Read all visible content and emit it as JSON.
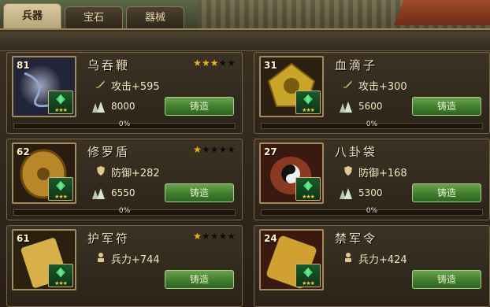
{
  "tabs": [
    {
      "label": "兵器",
      "active": true
    },
    {
      "label": "宝石",
      "active": false
    },
    {
      "label": "器械",
      "active": false
    }
  ],
  "forge_label": "铸造",
  "items": [
    {
      "level": "81",
      "name": "乌吞鞭",
      "stars_on": 3,
      "stars_total": 5,
      "stat_icon": "sword-icon",
      "stat": "攻击+595",
      "cost": "8000",
      "progress": "0%",
      "progress_value": 0,
      "gem_color": "#3bd06a"
    },
    {
      "level": "31",
      "name": "血滴子",
      "stars_on": 0,
      "stars_total": 0,
      "stat_icon": "sword-icon",
      "stat": "攻击+300",
      "cost": "5600",
      "progress": "0%",
      "progress_value": 0,
      "gem_color": "#3bd06a"
    },
    {
      "level": "62",
      "name": "修罗盾",
      "stars_on": 1,
      "stars_total": 5,
      "stat_icon": "shield-icon",
      "stat": "防御+282",
      "cost": "6550",
      "progress": "0%",
      "progress_value": 0,
      "gem_color": "#3bd06a"
    },
    {
      "level": "27",
      "name": "八卦袋",
      "stars_on": 0,
      "stars_total": 0,
      "stat_icon": "shield-icon",
      "stat": "防御+168",
      "cost": "5300",
      "progress": "0%",
      "progress_value": 0,
      "gem_color": "#3bd06a"
    },
    {
      "level": "61",
      "name": "护军符",
      "stars_on": 1,
      "stars_total": 5,
      "stat_icon": "soldier-icon",
      "stat": "兵力+744",
      "cost": "",
      "progress": "",
      "progress_value": 0,
      "gem_color": "#3bd06a"
    },
    {
      "level": "24",
      "name": "禁军令",
      "stars_on": 0,
      "stars_total": 0,
      "stat_icon": "soldier-icon",
      "stat": "兵力+424",
      "cost": "",
      "progress": "",
      "progress_value": 0,
      "gem_color": "#3bd06a"
    }
  ]
}
